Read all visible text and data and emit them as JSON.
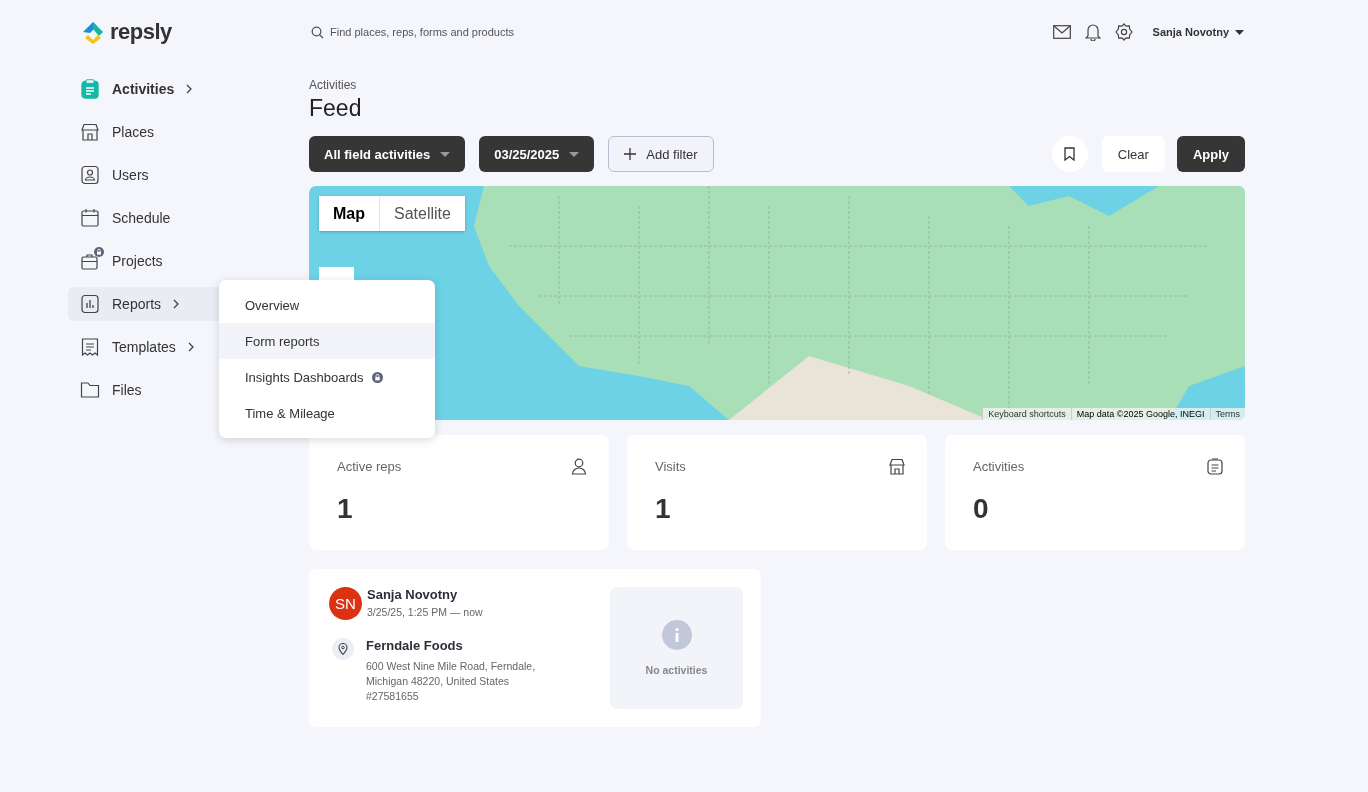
{
  "header": {
    "logo": "repsly",
    "search": {
      "placeholder": "Find places, reps, forms and products"
    },
    "user": "Sanja Novotny"
  },
  "sidebar": {
    "items": [
      {
        "label": "Activities",
        "selected": true,
        "expanded": false,
        "submenu": true,
        "locked": false
      },
      {
        "label": "Places",
        "selected": false,
        "expanded": false,
        "submenu": false,
        "locked": false
      },
      {
        "label": "Users",
        "selected": false,
        "expanded": false,
        "submenu": false,
        "locked": false
      },
      {
        "label": "Schedule",
        "selected": false,
        "expanded": false,
        "submenu": false,
        "locked": false
      },
      {
        "label": "Projects",
        "selected": false,
        "expanded": false,
        "submenu": false,
        "locked": true
      },
      {
        "label": "Reports",
        "selected": false,
        "expanded": true,
        "submenu": true,
        "locked": false
      },
      {
        "label": "Templates",
        "selected": false,
        "expanded": false,
        "submenu": true,
        "locked": false
      },
      {
        "label": "Files",
        "selected": false,
        "expanded": false,
        "submenu": false,
        "locked": false
      }
    ]
  },
  "reports_menu": {
    "items": [
      {
        "label": "Overview",
        "highlighted": false,
        "locked": false
      },
      {
        "label": "Form reports",
        "highlighted": true,
        "locked": false
      },
      {
        "label": "Insights Dashboards",
        "highlighted": false,
        "locked": true
      },
      {
        "label": "Time & Mileage",
        "highlighted": false,
        "locked": false
      }
    ]
  },
  "page": {
    "breadcrumb": "Activities",
    "title": "Feed"
  },
  "filters": [
    {
      "label": "All field activities",
      "kind": "dropdown"
    },
    {
      "label": "03/25/2025",
      "kind": "dropdown"
    },
    {
      "label": "Add filter",
      "kind": "add"
    }
  ],
  "actions": [
    {
      "label": "Clear",
      "kind": "secondary"
    },
    {
      "label": "Apply",
      "kind": "primary"
    }
  ],
  "map": {
    "map_types": [
      {
        "label": "Map",
        "selected": true
      },
      {
        "label": "Satellite",
        "selected": false
      }
    ],
    "attribution": [
      "Keyboard shortcuts",
      "Map data ©2025 Google, INEGI",
      "Terms"
    ]
  },
  "stats": [
    {
      "label": "Active reps",
      "value": "1"
    },
    {
      "label": "Visits",
      "value": "1"
    },
    {
      "label": "Activities",
      "value": "0"
    }
  ],
  "feed": [
    {
      "initials": "SN",
      "color": "#dc3214",
      "name": "Sanja Novotny",
      "time": "3/25/25, 1:25 PM — now",
      "place": "Ferndale Foods",
      "address": "600 West Nine Mile Road, Ferndale, Michigan 48220, United States",
      "number": "#27581655",
      "activities_message": "No activities"
    }
  ]
}
